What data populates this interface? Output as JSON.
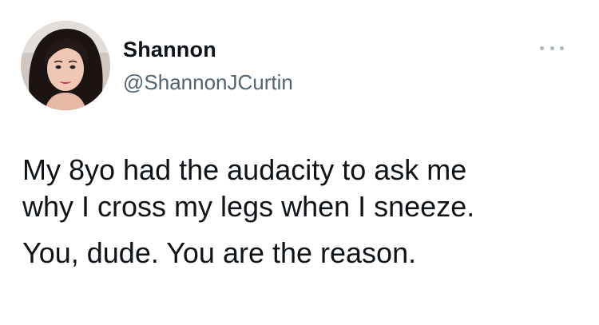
{
  "user": {
    "display_name": "Shannon",
    "handle": "@ShannonJCurtin"
  },
  "tweet": {
    "line1": "My 8yo had the audacity to ask me",
    "line2": "why I cross my legs when I sneeze.",
    "line3": "You, dude. You are the reason."
  },
  "icons": {
    "more": "more-options-icon",
    "avatar": "profile-photo"
  }
}
